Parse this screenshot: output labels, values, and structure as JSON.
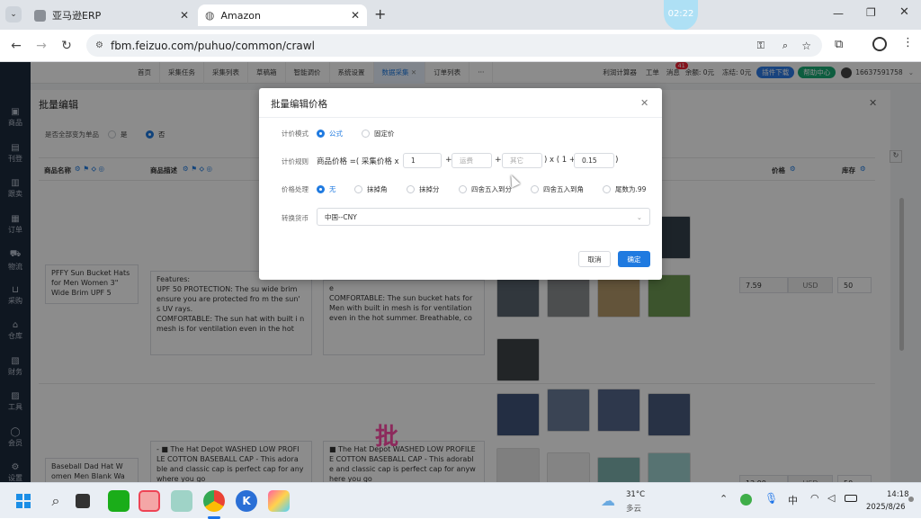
{
  "browser": {
    "tabs": [
      {
        "label": "亚马逊ERP"
      },
      {
        "label": "Amazon"
      }
    ],
    "timer_badge": "02:22",
    "url": "fbm.feizuo.com/puhuo/common/crawl"
  },
  "sidebar": {
    "items": [
      {
        "label": "商品",
        "icon": "box-icon"
      },
      {
        "label": "刊登",
        "icon": "publish-icon"
      },
      {
        "label": "跟卖",
        "icon": "follow-icon"
      },
      {
        "label": "订单",
        "icon": "order-icon"
      },
      {
        "label": "物流",
        "icon": "truck-icon"
      },
      {
        "label": "采购",
        "icon": "cart-icon"
      },
      {
        "label": "仓库",
        "icon": "warehouse-icon"
      },
      {
        "label": "财务",
        "icon": "finance-icon"
      },
      {
        "label": "工具",
        "icon": "tool-icon"
      },
      {
        "label": "会员",
        "icon": "member-icon"
      },
      {
        "label": "设置",
        "icon": "gear-icon"
      }
    ]
  },
  "topnav": {
    "items": [
      "首页",
      "采集任务",
      "采集列表",
      "草稿箱",
      "智能调价",
      "系统设置",
      "数据采集",
      "订单列表",
      "···"
    ],
    "active_index": 6,
    "profit_calc": "利润计算器",
    "ticket": "工单",
    "messages": "消息",
    "message_count": "41",
    "balance": "余额: 0元",
    "frozen": "冻结: 0元",
    "plugin_download": "插件下载",
    "help_center": "帮助中心",
    "phone": "16637591758"
  },
  "panel": {
    "title": "批量编辑",
    "single_question": "是否全部变为单品",
    "yes": "是",
    "no": "否",
    "columns": {
      "name": "商品名称",
      "desc": "商品描述",
      "price": "价格",
      "stock": "库存"
    },
    "rows": [
      {
        "name": "PFFY Sun Bucket Hats for Men Women 3\" Wide Brim UPF 5",
        "desc1": "Features:\nUPF 50 PROTECTION: The su wide brim ensure you are protected fro m the sun' s UV rays.\nCOMFORTABLE: The sun hat with built i n mesh is for ventilation even in the hot",
        "desc2": "e\nCOMFORTABLE: The sun bucket hats for Men with built in mesh is for ventilation even in the hot summer. Breathable, co",
        "price": "7.59",
        "currency": "USD",
        "stock": "50"
      },
      {
        "name": "Baseball Dad Hat W omen Men Blank Wa",
        "desc1": "- ■ The Hat Depot WASHED LOW PROFI LE COTTON BASEBALL CAP - This adora ble and classic cap is perfect cap for any where you go",
        "desc2": "■ The Hat Depot WASHED LOW PROFILE E COTTON BASEBALL CAP - This adorabl e and classic cap is perfect cap for anyw here you go",
        "price": "12.99",
        "currency": "USD",
        "stock": "50"
      }
    ],
    "watermark": "批"
  },
  "modal": {
    "title": "批量编辑价格",
    "mode_label": "计价模式",
    "mode_options": [
      "公式",
      "固定价"
    ],
    "rule_label": "计价规则",
    "rule_prefix": "商品价格 =( 采集价格 x",
    "multiplier": "1",
    "plus": "+",
    "shipping_placeholder": "运费",
    "other_placeholder": "其它",
    "mid": ") x ( 1 +",
    "rate": "0.15",
    "close_paren": ")",
    "process_label": "价格处理",
    "process_options": [
      "无",
      "抹掉角",
      "抹掉分",
      "四舍五入到分",
      "四舍五入到角",
      "尾数为.99"
    ],
    "currency_label": "转换货币",
    "currency_value": "中国--CNY",
    "cancel": "取消",
    "confirm": "确定"
  },
  "taskbar": {
    "weather_temp": "31°C",
    "weather_desc": "多云",
    "ime": "中",
    "time": "14:18",
    "date": "2025/8/26"
  }
}
